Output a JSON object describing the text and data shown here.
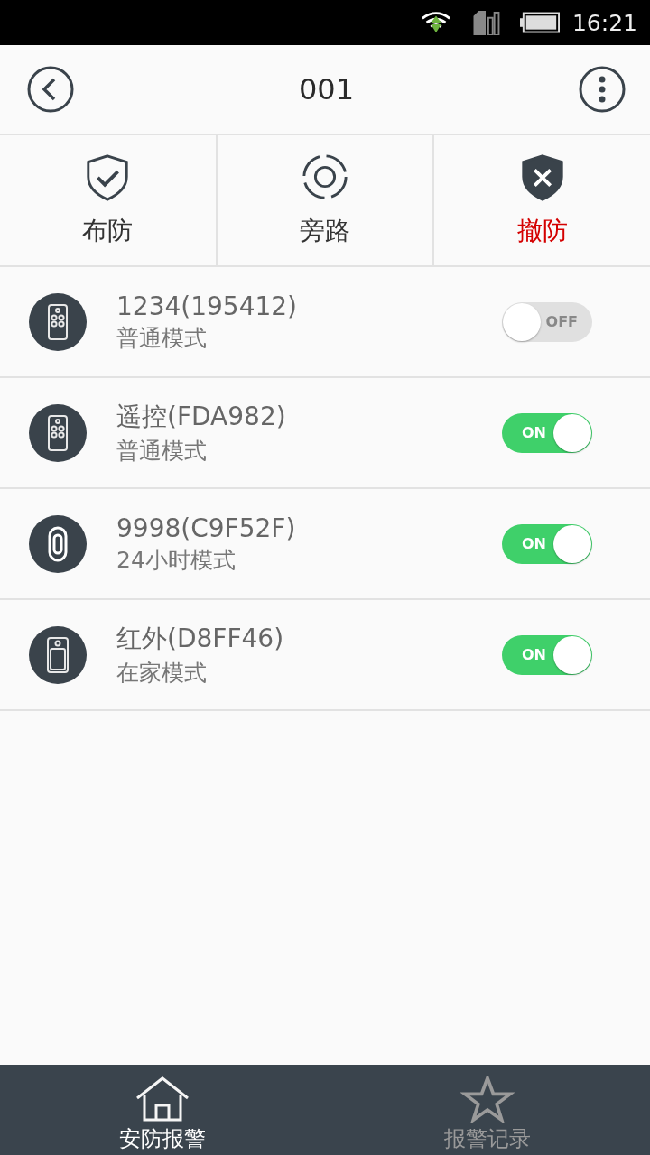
{
  "status_bar": {
    "time": "16:21"
  },
  "header": {
    "title": "001"
  },
  "modes": [
    {
      "kind": "arm",
      "label": "布防",
      "selected": false
    },
    {
      "kind": "bypass",
      "label": "旁路",
      "selected": false
    },
    {
      "kind": "disarm",
      "label": "撤防",
      "selected": true
    }
  ],
  "devices": [
    {
      "kind": "remote",
      "name": "1234(195412)",
      "mode": "普通模式",
      "on": false,
      "switch_text": "OFF"
    },
    {
      "kind": "remote",
      "name": "遥控(FDA982)",
      "mode": "普通模式",
      "on": true,
      "switch_text": "ON"
    },
    {
      "kind": "contact",
      "name": "9998(C9F52F)",
      "mode": "24小时模式",
      "on": true,
      "switch_text": "ON"
    },
    {
      "kind": "infrared",
      "name": "红外(D8FF46)",
      "mode": "在家模式",
      "on": true,
      "switch_text": "ON"
    }
  ],
  "bottom_nav": [
    {
      "kind": "home",
      "label": "安防报警",
      "selected": true
    },
    {
      "kind": "star",
      "label": "报警记录",
      "selected": false
    }
  ]
}
